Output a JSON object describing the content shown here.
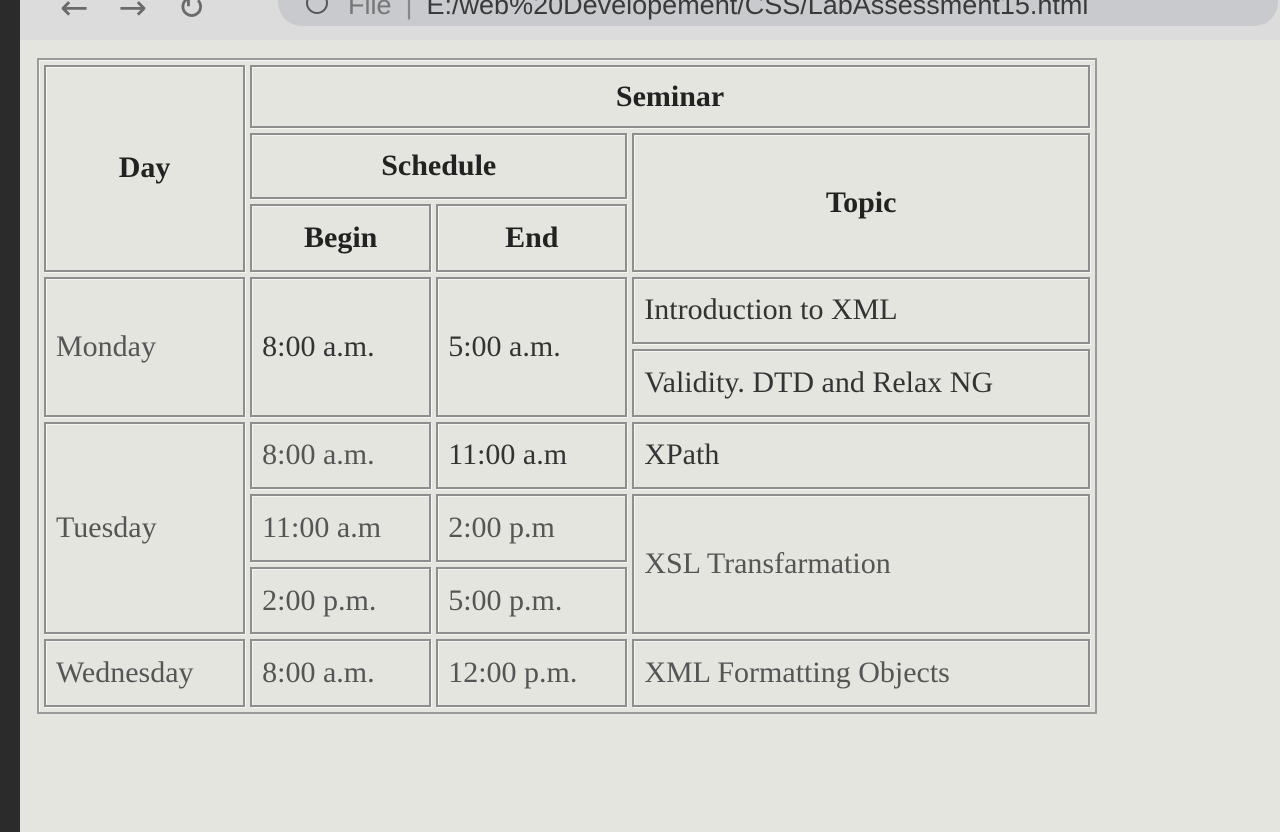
{
  "browser": {
    "url_prefix": "File",
    "url_separator": "|",
    "url": "E:/web%20Developement/CSS/LabAssessment15.html"
  },
  "table": {
    "headers": {
      "day": "Day",
      "seminar": "Seminar",
      "schedule": "Schedule",
      "topic": "Topic",
      "begin": "Begin",
      "end": "End"
    },
    "monday": {
      "day": "Monday",
      "begin": "8:00 a.m.",
      "end": "5:00 a.m.",
      "topic1": "Introduction to XML",
      "topic2": "Validity. DTD and Relax NG"
    },
    "tuesday": {
      "day": "Tuesday",
      "row1": {
        "begin": "8:00 a.m.",
        "end": "11:00 a.m",
        "topic": "XPath"
      },
      "row2": {
        "begin": "11:00 a.m",
        "end": "2:00 p.m",
        "topic": "XSL Transfarmation"
      },
      "row3": {
        "begin": "2:00 p.m.",
        "end": "5:00 p.m."
      }
    },
    "wednesday": {
      "day": "Wednesday",
      "begin": "8:00 a.m.",
      "end": "12:00 p.m.",
      "topic": "XML Formatting Objects"
    }
  }
}
